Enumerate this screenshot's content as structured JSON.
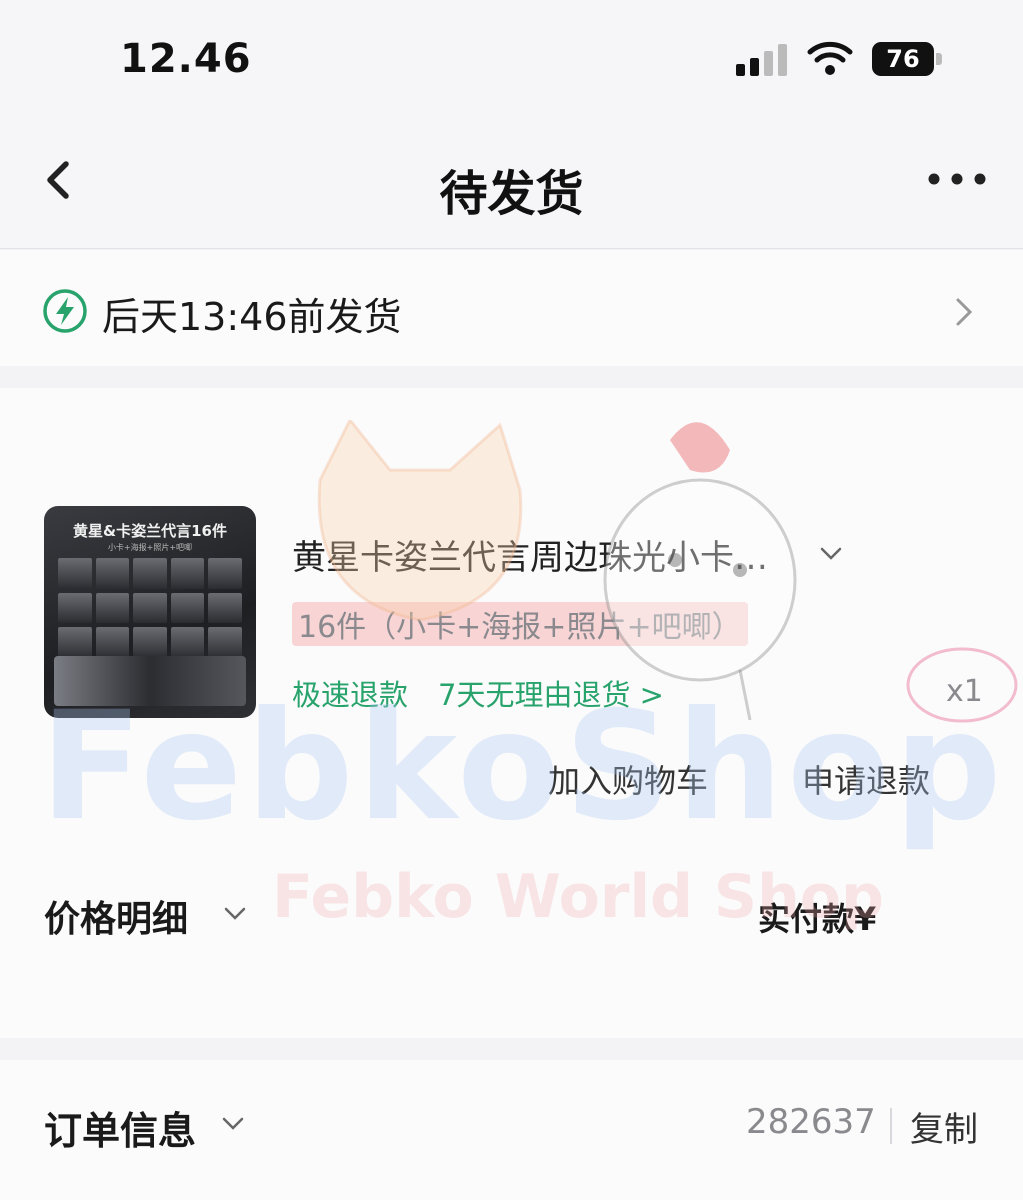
{
  "status_bar": {
    "time": "12.46",
    "battery": "76"
  },
  "nav": {
    "title": "待发货"
  },
  "shipping": {
    "text": "后天13:46前发货"
  },
  "product": {
    "image_title": "黄星&卡姿兰代言16件",
    "image_subtitle": "小卡+海报+照片+吧唧",
    "title": "黄星卡姿兰代言周边珠光小卡…",
    "variant": "16件（小卡+海报+照片+吧唧）",
    "badge_refund": "极速退款",
    "badge_return": "7天无理由退货 >",
    "quantity": "x1",
    "add_to_cart": "加入购物车",
    "request_refund": "申请退款"
  },
  "price": {
    "label": "价格明细",
    "paid_label": "实付款¥"
  },
  "order": {
    "label": "订单信息",
    "number_partial": "282637",
    "copy": "复制"
  },
  "watermark": {
    "main": "FebkoShop",
    "sub": "Febko World Shop"
  },
  "colors": {
    "accent_green": "#27a36b",
    "bg": "#f3f3f5"
  }
}
